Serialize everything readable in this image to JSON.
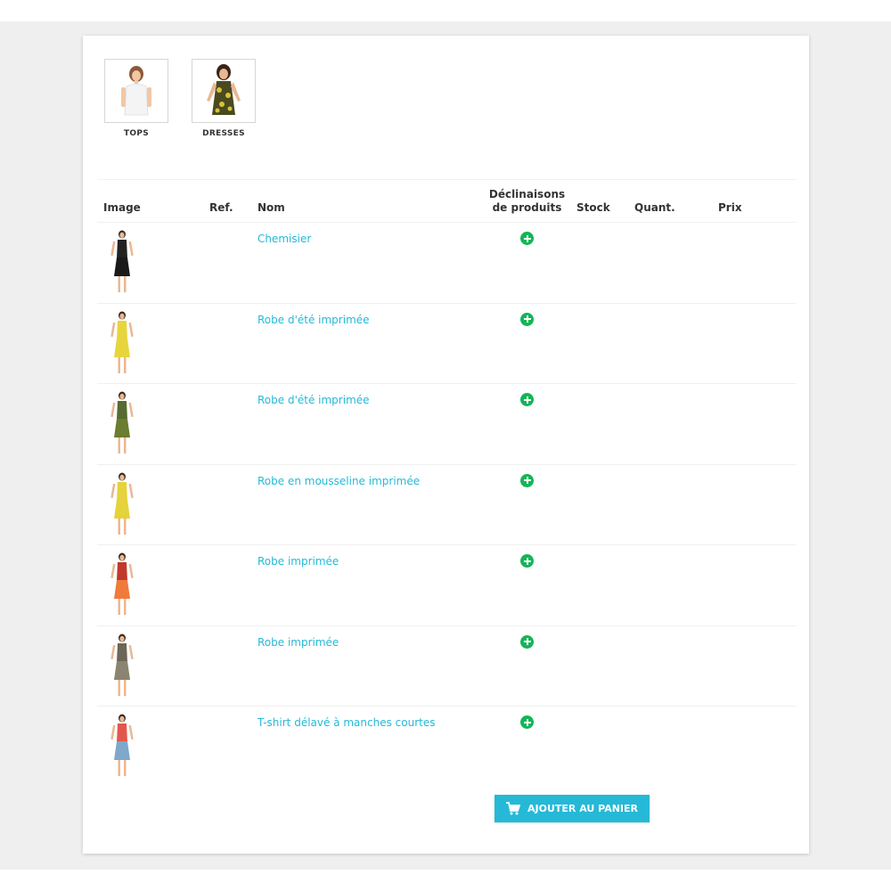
{
  "categories": [
    {
      "label": "TOPS",
      "icon": "woman-white-top-icon"
    },
    {
      "label": "DRESSES",
      "icon": "woman-yellow-dress-icon"
    }
  ],
  "table": {
    "headers": {
      "image": "Image",
      "ref": "Ref.",
      "name": "Nom",
      "variants_line1": "Déclinaisons",
      "variants_line2": "de produits",
      "stock": "Stock",
      "quantity": "Quant.",
      "price": "Prix"
    },
    "rows": [
      {
        "name": "Chemisier",
        "top": "#222222",
        "bottom": "#1a1a1a"
      },
      {
        "name": "Robe d'été imprimée",
        "top": "#e8d53c",
        "bottom": "#e8d53c"
      },
      {
        "name": "Robe d'été imprimée",
        "top": "#556b2f",
        "bottom": "#6b7d2e"
      },
      {
        "name": "Robe en mousseline imprimée",
        "top": "#e6d23a",
        "bottom": "#e6d23a"
      },
      {
        "name": "Robe imprimée",
        "top": "#c0392b",
        "bottom": "#f07a3a"
      },
      {
        "name": "Robe imprimée",
        "top": "#6b6656",
        "bottom": "#8a8470"
      },
      {
        "name": "T-shirt délavé à manches courtes",
        "top": "#e2574c",
        "bottom": "#7fa7c9"
      }
    ]
  },
  "cart_button": {
    "label": "AJOUTER AU PANIER",
    "icon": "cart-icon"
  },
  "colors": {
    "accent": "#25b9d7",
    "add_icon": "#12b656"
  }
}
